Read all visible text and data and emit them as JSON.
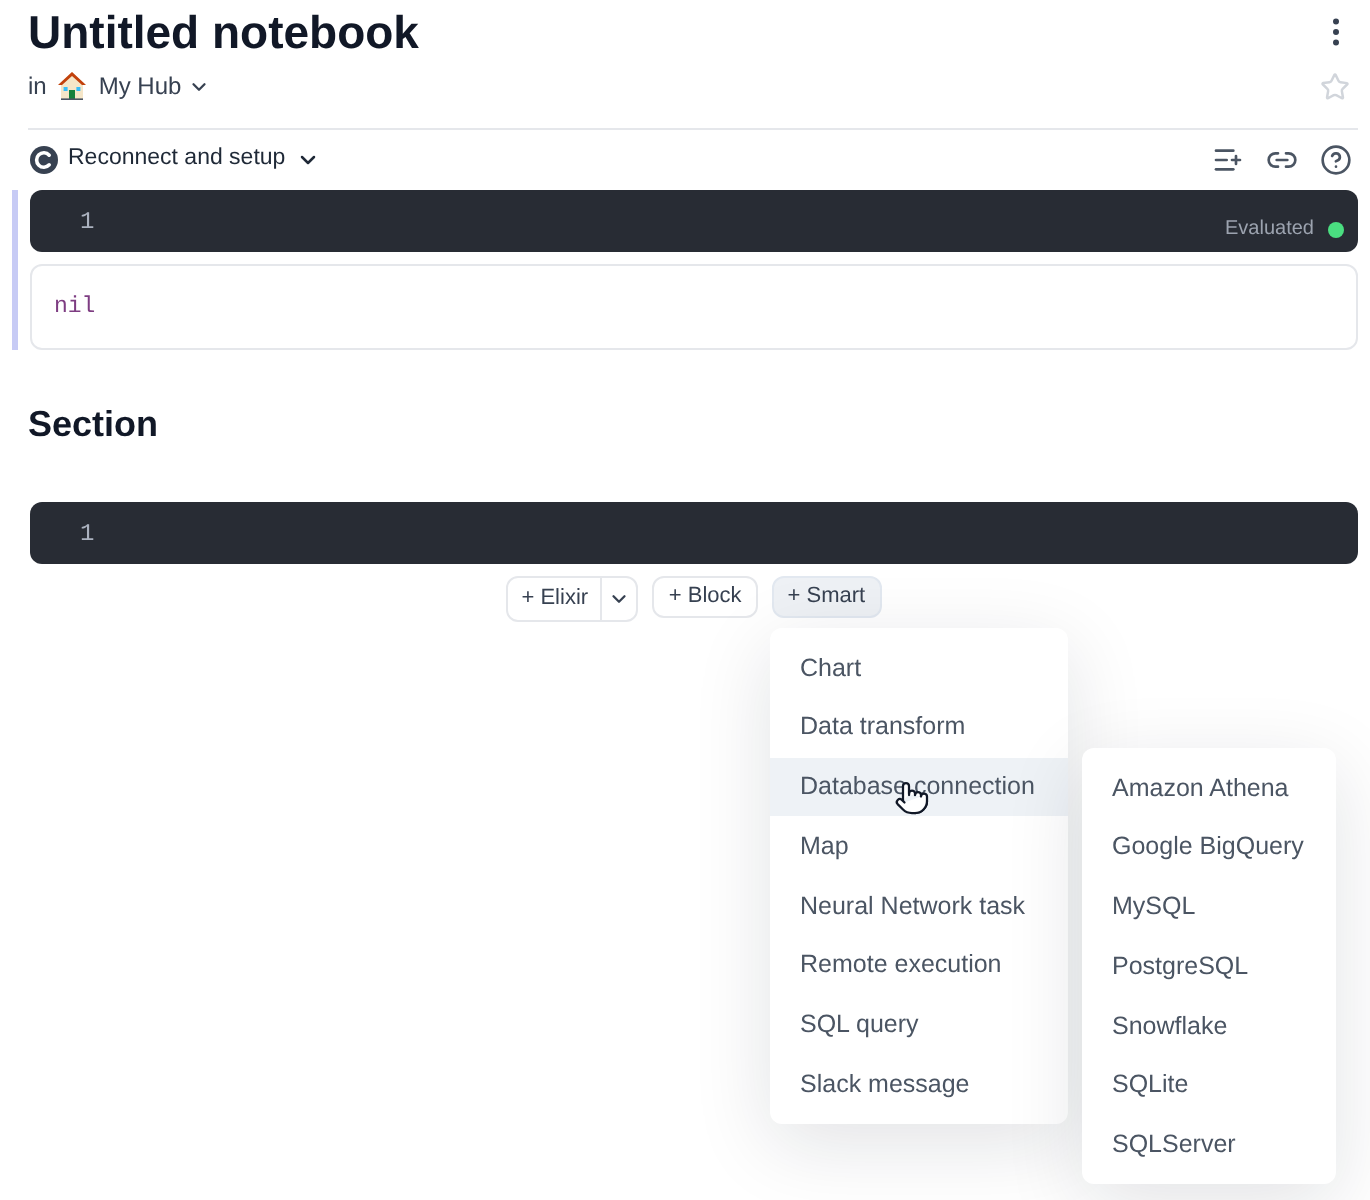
{
  "header": {
    "title": "Untitled notebook",
    "location_prefix": "in",
    "hub_name": "My Hub"
  },
  "runtime": {
    "label": "Reconnect and setup"
  },
  "setup_cell": {
    "line_number": "1",
    "status": "Evaluated",
    "output": "nil"
  },
  "sections": [
    {
      "title": "Section",
      "cells": [
        {
          "line_number": "1"
        }
      ]
    }
  ],
  "insert_buttons": [
    {
      "label": "+ Elixir",
      "kind": "split",
      "selected": false
    },
    {
      "label": "+ Block",
      "kind": "plain",
      "selected": false
    },
    {
      "label": "+ Smart",
      "kind": "plain",
      "selected": true
    }
  ],
  "smart_menu": {
    "items": [
      {
        "label": "Chart",
        "selected": false
      },
      {
        "label": "Data transform",
        "selected": false
      },
      {
        "label": "Database connection",
        "selected": true
      },
      {
        "label": "Map",
        "selected": false
      },
      {
        "label": "Neural Network task",
        "selected": false
      },
      {
        "label": "Remote execution",
        "selected": false
      },
      {
        "label": "SQL query",
        "selected": false
      },
      {
        "label": "Slack message",
        "selected": false
      }
    ]
  },
  "database_submenu": {
    "items": [
      {
        "label": "Amazon Athena"
      },
      {
        "label": "Google BigQuery"
      },
      {
        "label": "MySQL"
      },
      {
        "label": "PostgreSQL"
      },
      {
        "label": "Snowflake"
      },
      {
        "label": "SQLite"
      },
      {
        "label": "SQLServer"
      }
    ]
  }
}
